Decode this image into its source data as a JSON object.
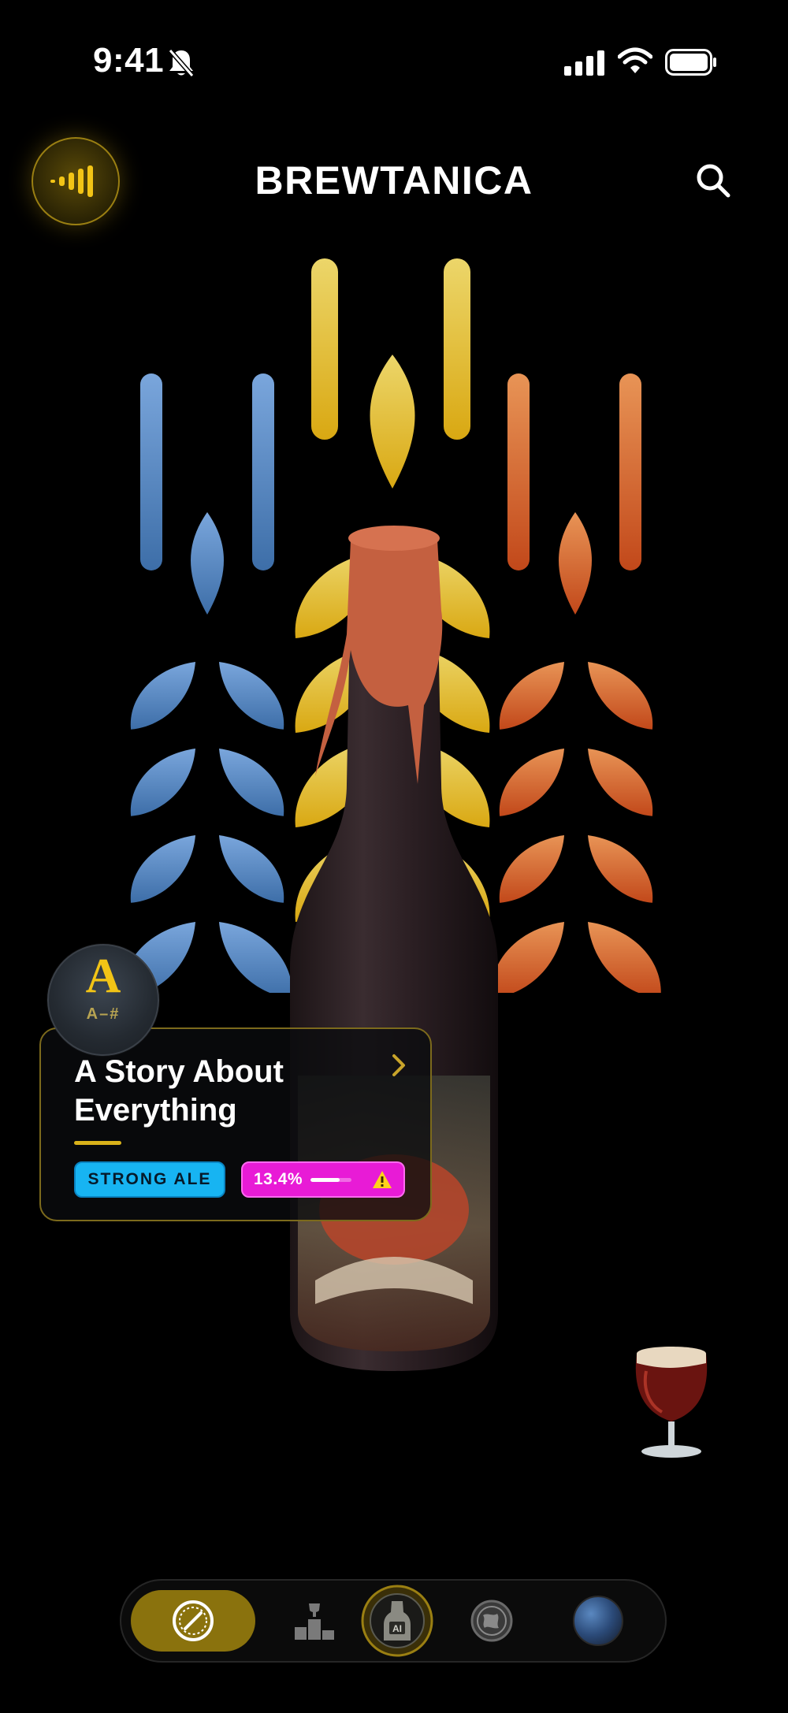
{
  "status_bar": {
    "time": "9:41"
  },
  "header": {
    "title": "BREWTANICA"
  },
  "beer": {
    "grade": "A",
    "grade_detail": "A–#",
    "name": "A Story About Everything",
    "style": "STRONG ALE",
    "abv": "13.4%",
    "abv_level": 0.72
  },
  "colors": {
    "accent": "#f2c416",
    "style_tag": "#17b4f2",
    "abv_tag": "#e81bd6",
    "active_tab": "#8a720d"
  },
  "nav": {
    "tabs": [
      {
        "icon": "bottle-cap-icon",
        "active": true
      },
      {
        "icon": "podium-icon",
        "active": false
      },
      {
        "icon": "ai-scan-icon",
        "active": false
      },
      {
        "icon": "globe-icon",
        "active": false
      },
      {
        "icon": "avatar",
        "active": false
      }
    ]
  }
}
